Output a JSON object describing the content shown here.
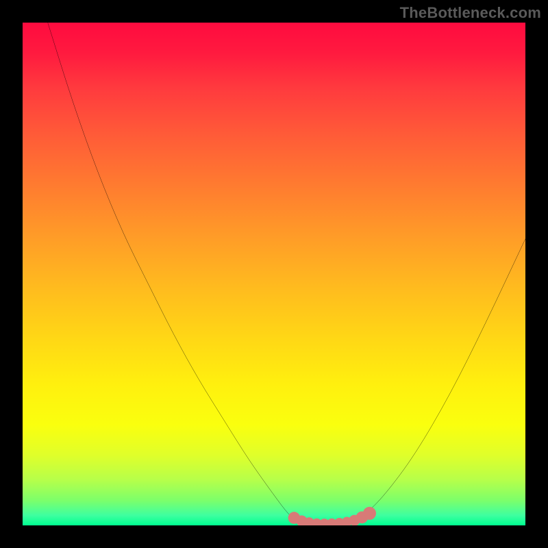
{
  "watermark": "TheBottleneck.com",
  "colors": {
    "background": "#000000",
    "curve_stroke": "#000000",
    "marker_fill": "#d87a77",
    "watermark_text": "#5a5a5a",
    "gradient_top": "#ff0b3f",
    "gradient_bottom": "#00ff90"
  },
  "chart_data": {
    "type": "line",
    "title": "",
    "xlabel": "",
    "ylabel": "",
    "xlim": [
      0,
      100
    ],
    "ylim": [
      0,
      100
    ],
    "grid": false,
    "legend_position": "none",
    "curve_points": [
      {
        "x": 5,
        "y": 100
      },
      {
        "x": 10,
        "y": 84
      },
      {
        "x": 15,
        "y": 70
      },
      {
        "x": 20,
        "y": 58
      },
      {
        "x": 25,
        "y": 48
      },
      {
        "x": 30,
        "y": 38
      },
      {
        "x": 35,
        "y": 29
      },
      {
        "x": 40,
        "y": 21
      },
      {
        "x": 45,
        "y": 13
      },
      {
        "x": 50,
        "y": 6
      },
      {
        "x": 53,
        "y": 2
      },
      {
        "x": 55,
        "y": 0.6
      },
      {
        "x": 58,
        "y": 0.3
      },
      {
        "x": 62,
        "y": 0.3
      },
      {
        "x": 65,
        "y": 0.6
      },
      {
        "x": 68,
        "y": 2
      },
      {
        "x": 72,
        "y": 6
      },
      {
        "x": 78,
        "y": 14
      },
      {
        "x": 85,
        "y": 26
      },
      {
        "x": 92,
        "y": 40
      },
      {
        "x": 100,
        "y": 57
      }
    ],
    "markers": [
      {
        "x": 54,
        "y": 1.5,
        "r": 1.2
      },
      {
        "x": 55.5,
        "y": 0.9,
        "r": 1.1
      },
      {
        "x": 57,
        "y": 0.6,
        "r": 1.0
      },
      {
        "x": 58.5,
        "y": 0.4,
        "r": 1.0
      },
      {
        "x": 60,
        "y": 0.35,
        "r": 1.0
      },
      {
        "x": 61.5,
        "y": 0.4,
        "r": 1.0
      },
      {
        "x": 63,
        "y": 0.5,
        "r": 1.0
      },
      {
        "x": 64.5,
        "y": 0.7,
        "r": 1.0
      },
      {
        "x": 66,
        "y": 1.0,
        "r": 1.1
      },
      {
        "x": 67.5,
        "y": 1.6,
        "r": 1.2
      },
      {
        "x": 69,
        "y": 2.4,
        "r": 1.3
      }
    ]
  }
}
